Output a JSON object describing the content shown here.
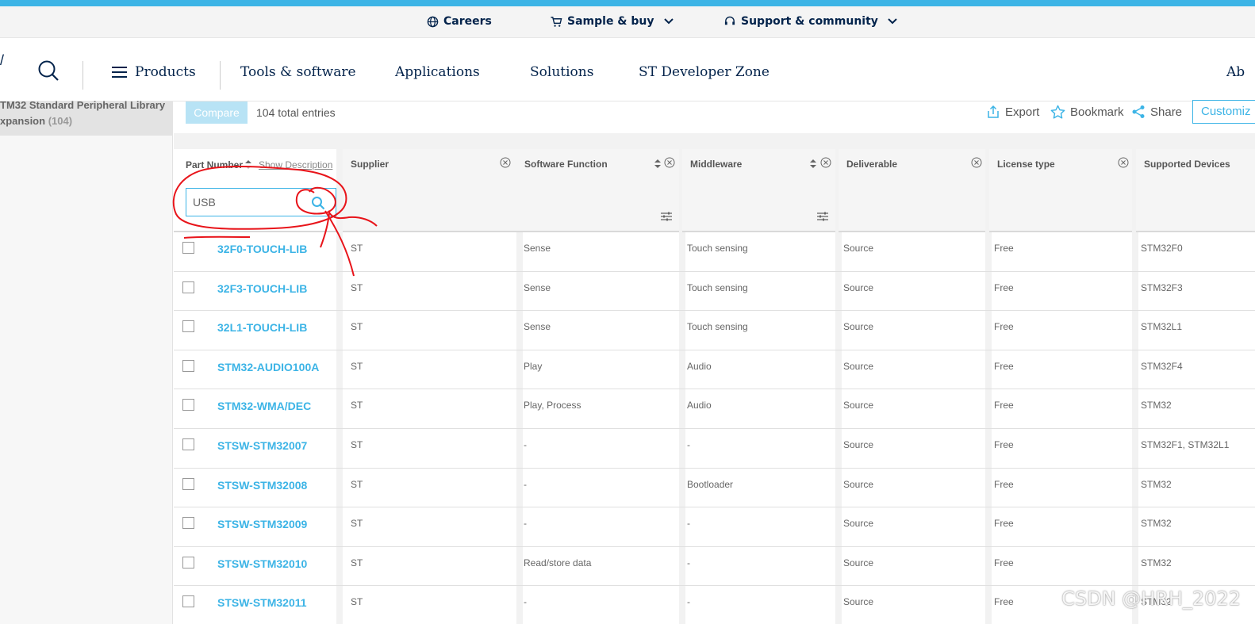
{
  "utility_bar": {
    "careers": "Careers",
    "sample_buy": "Sample & buy",
    "support": "Support & community"
  },
  "main_nav": {
    "slash": "/",
    "products": "Products",
    "tools": "Tools & software",
    "applications": "Applications",
    "solutions": "Solutions",
    "dev_zone": "ST Developer Zone",
    "about_partial": "Ab"
  },
  "sidebar": {
    "filter_line1": "TM32 Standard Peripheral Library",
    "filter_line2": "xpansion",
    "filter_count": "(104)"
  },
  "toolbar": {
    "compare": "Compare",
    "total": "104 total entries",
    "export": "Export",
    "bookmark": "Bookmark",
    "share": "Share",
    "customize": "Customiz"
  },
  "table": {
    "part_header": "Part Number",
    "show_description": "Show Description",
    "search_value": "USB",
    "headers": {
      "supplier": "Supplier",
      "software_function": "Software Function",
      "middleware": "Middleware",
      "deliverable": "Deliverable",
      "license": "License type",
      "devices": "Supported Devices"
    },
    "rows": [
      {
        "part": "32F0-TOUCH-LIB",
        "supplier": "ST",
        "function": "Sense",
        "middleware": "Touch sensing",
        "deliverable": "Source",
        "license": "Free",
        "devices": "STM32F0"
      },
      {
        "part": "32F3-TOUCH-LIB",
        "supplier": "ST",
        "function": "Sense",
        "middleware": "Touch sensing",
        "deliverable": "Source",
        "license": "Free",
        "devices": "STM32F3"
      },
      {
        "part": "32L1-TOUCH-LIB",
        "supplier": "ST",
        "function": "Sense",
        "middleware": "Touch sensing",
        "deliverable": "Source",
        "license": "Free",
        "devices": "STM32L1"
      },
      {
        "part": "STM32-AUDIO100A",
        "supplier": "ST",
        "function": "Play",
        "middleware": "Audio",
        "deliverable": "Source",
        "license": "Free",
        "devices": "STM32F4"
      },
      {
        "part": "STM32-WMA/DEC",
        "supplier": "ST",
        "function": "Play, Process",
        "middleware": "Audio",
        "deliverable": "Source",
        "license": "Free",
        "devices": "STM32"
      },
      {
        "part": "STSW-STM32007",
        "supplier": "ST",
        "function": "-",
        "middleware": "-",
        "deliverable": "Source",
        "license": "Free",
        "devices": "STM32F1, STM32L1"
      },
      {
        "part": "STSW-STM32008",
        "supplier": "ST",
        "function": "-",
        "middleware": "Bootloader",
        "deliverable": "Source",
        "license": "Free",
        "devices": "STM32"
      },
      {
        "part": "STSW-STM32009",
        "supplier": "ST",
        "function": "-",
        "middleware": "-",
        "deliverable": "Source",
        "license": "Free",
        "devices": "STM32"
      },
      {
        "part": "STSW-STM32010",
        "supplier": "ST",
        "function": "Read/store data",
        "middleware": "-",
        "deliverable": "Source",
        "license": "Free",
        "devices": "STM32"
      },
      {
        "part": "STSW-STM32011",
        "supplier": "ST",
        "function": "-",
        "middleware": "-",
        "deliverable": "Source",
        "license": "Free",
        "devices": "STM32"
      }
    ]
  },
  "watermark": "CSDN @HRH_2022",
  "colors": {
    "accent": "#3cb4e6",
    "navy": "#03234b",
    "annotation": "#e8141a"
  }
}
